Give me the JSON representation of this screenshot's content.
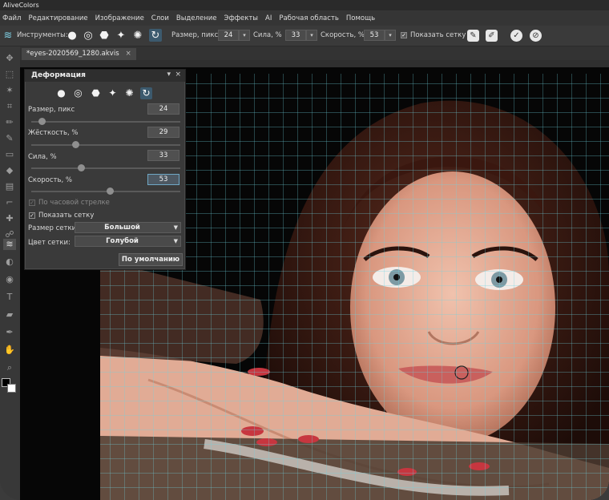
{
  "app": {
    "title": "AliveColors"
  },
  "menu": [
    "Файл",
    "Редактирование",
    "Изображение",
    "Слои",
    "Выделение",
    "Эффекты",
    "AI",
    "Рабочая область",
    "Помощь"
  ],
  "options": {
    "tools_label": "Инструменты:",
    "size_label": "Размер, пикс",
    "size_value": "24",
    "strength_label": "Сила, %",
    "strength_value": "33",
    "speed_label": "Скорость, %",
    "speed_value": "53",
    "show_grid_label": "Показать сетку",
    "show_grid_checked": "✓"
  },
  "document": {
    "tab_title": "*eyes-2020569_1280.akvis",
    "close": "×"
  },
  "panel": {
    "title": "Деформация",
    "menu_glyph": "▾",
    "close_glyph": "×",
    "size_label": "Размер, пикс",
    "size_value": "24",
    "size_level": 0.05,
    "hardness_label": "Жёсткость, %",
    "hardness_value": "29",
    "hardness_level": 0.29,
    "strength_label": "Сила, %",
    "strength_value": "33",
    "strength_level": 0.33,
    "speed_label": "Скорость, %",
    "speed_value": "53",
    "speed_level": 0.53,
    "clockwise_label": "По часовой стрелке",
    "clockwise_checked": "✓",
    "show_grid_label": "Показать сетку",
    "show_grid_checked": "✓",
    "grid_size_label": "Размер сетки:",
    "grid_size_value": "Большой",
    "grid_color_label": "Цвет сетки:",
    "grid_color_value": "Голубой",
    "default_button": "По умолчанию"
  },
  "colors": {
    "grid": "#6fd3e0",
    "accent": "#3c5a6e",
    "foreground": "#000000",
    "background": "#ffffff"
  },
  "icons": [
    "wave-logo-icon",
    "push-tool-icon",
    "twirl-left-icon",
    "bloat-icon",
    "pinch-icon",
    "twirl-icon",
    "restore-icon"
  ]
}
